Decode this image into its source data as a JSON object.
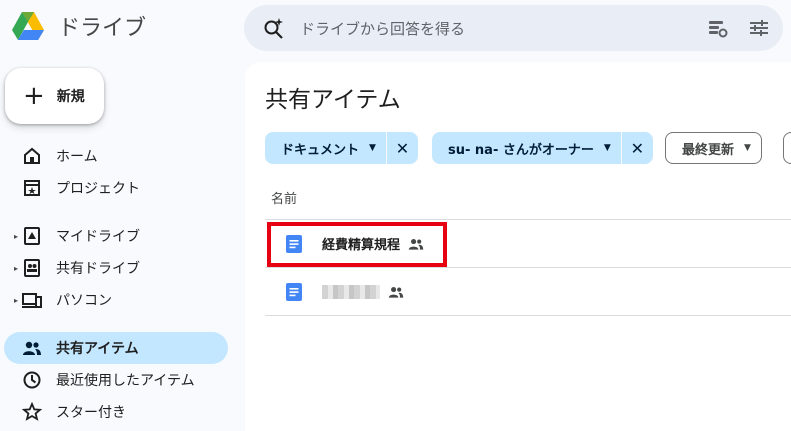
{
  "app": {
    "title": "ドライブ"
  },
  "search": {
    "placeholder": "ドライブから回答を得る"
  },
  "new_button": {
    "label": "新規"
  },
  "nav": {
    "items": [
      {
        "label": "ホーム",
        "icon": "home-icon"
      },
      {
        "label": "プロジェクト",
        "icon": "project-icon"
      },
      {
        "label": "マイドライブ",
        "icon": "my-drive-icon"
      },
      {
        "label": "共有ドライブ",
        "icon": "shared-drives-icon"
      },
      {
        "label": "パソコン",
        "icon": "computers-icon"
      },
      {
        "label": "共有アイテム",
        "icon": "shared-people-icon"
      },
      {
        "label": "最近使用したアイテム",
        "icon": "clock-icon"
      },
      {
        "label": "スター付き",
        "icon": "star-icon"
      }
    ],
    "active": "共有アイテム"
  },
  "main": {
    "title": "共有アイテム",
    "filters": [
      {
        "label": "ドキュメント"
      },
      {
        "label": "su- na- さんがオーナー"
      },
      {
        "label": "最終更新"
      }
    ],
    "column_name": "名前",
    "files": [
      {
        "name": "経費精算規程",
        "type": "google-doc"
      }
    ]
  },
  "colors": {
    "accent": "#c2e7ff",
    "doc_blue": "#4285f4",
    "highlight": "#e60012"
  }
}
